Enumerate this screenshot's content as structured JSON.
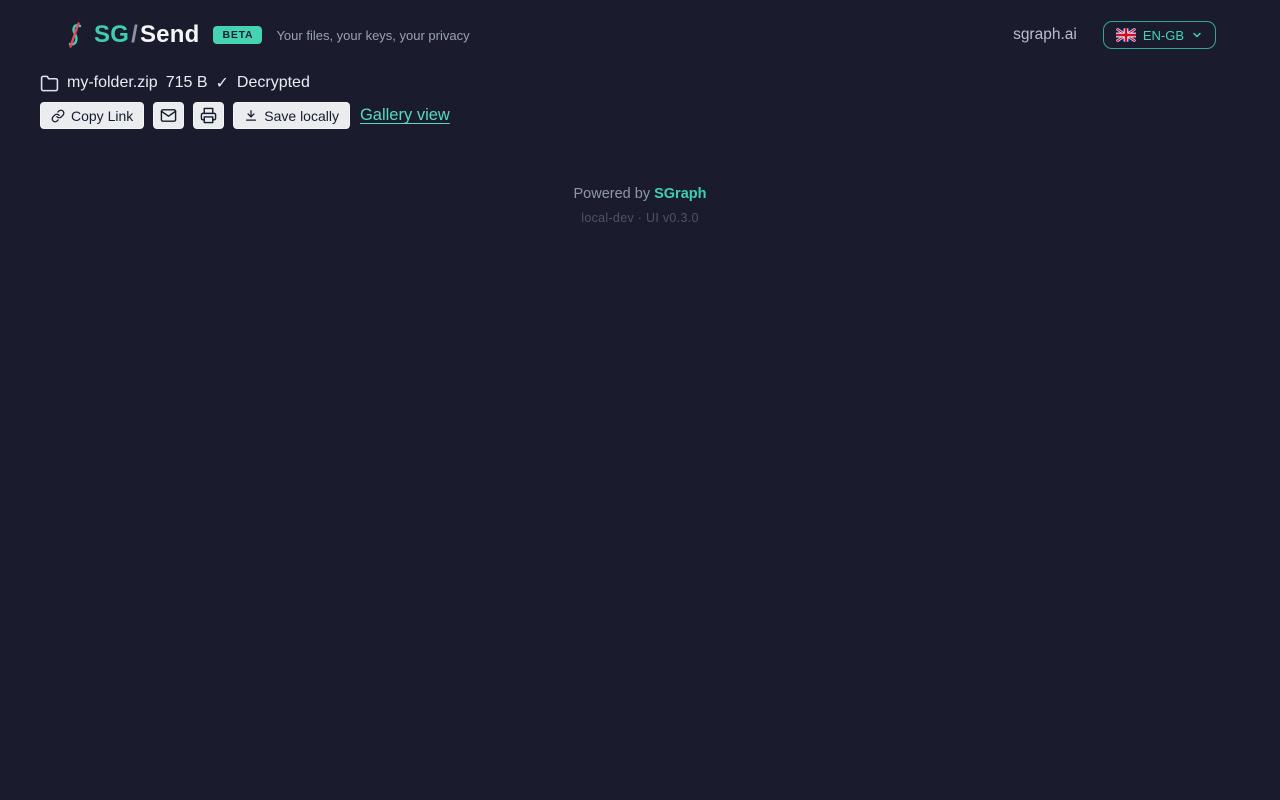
{
  "colors": {
    "background": "#1a1c2e",
    "accent_teal": "#3ecfae",
    "button_background": "#ebecee",
    "button_text": "#131c2e",
    "muted_text": "#98a1b3"
  },
  "header": {
    "logo": {
      "sg": "SG",
      "slash": "/",
      "send": "Send",
      "beta_badge": "BETA"
    },
    "tagline": "Your files, your keys, your privacy",
    "site_link": "sgraph.ai",
    "language_selector": {
      "label": "EN-GB",
      "flag_icon": "uk-flag-icon",
      "chevron_icon": "chevron-down-icon"
    }
  },
  "file_info": {
    "folder_icon": "folder-outline-icon",
    "name": "my-folder.zip",
    "size": "715 B",
    "check_mark": "✓",
    "status": "Decrypted"
  },
  "actions": {
    "copy_link_label": "Copy Link",
    "copy_link_icon": "link-icon",
    "email_icon": "envelope-icon",
    "print_icon": "printer-icon",
    "save_locally_label": "Save locally",
    "save_locally_icon": "download-icon",
    "gallery_view_label": "Gallery view"
  },
  "footer": {
    "powered_by_text": "Powered by ",
    "brand_link": "SGraph",
    "build_info": "local-dev · UI v0.3.0"
  }
}
